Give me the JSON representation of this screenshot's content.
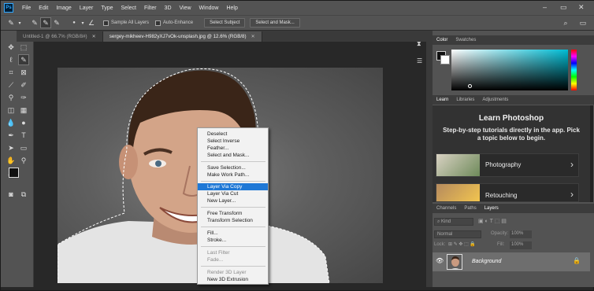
{
  "app": {
    "logo_text": "Ps"
  },
  "menubar": {
    "items": [
      "File",
      "Edit",
      "Image",
      "Layer",
      "Type",
      "Select",
      "Filter",
      "3D",
      "View",
      "Window",
      "Help"
    ]
  },
  "options_bar": {
    "sample_all_layers": "Sample All Layers",
    "auto_enhance": "Auto-Enhance",
    "select_subject": "Select Subject",
    "select_and_mask": "Select and Mask..."
  },
  "doc_tabs": [
    {
      "label": "Untitled-1 @ 66.7% (RGB/8#)"
    },
    {
      "label": "sergey-mikheev-H982yXJ7vOk-unsplash.jpg @ 12.6% (RGB/8)"
    }
  ],
  "context_menu": {
    "items": [
      {
        "label": "Deselect"
      },
      {
        "label": "Select Inverse"
      },
      {
        "label": "Feather..."
      },
      {
        "label": "Select and Mask..."
      },
      {
        "label": "Save Selection..."
      },
      {
        "label": "Make Work Path..."
      },
      {
        "label": "Layer Via Copy",
        "selected": true
      },
      {
        "label": "Layer Via Cut"
      },
      {
        "label": "New Layer..."
      },
      {
        "label": "Free Transform"
      },
      {
        "label": "Transform Selection"
      },
      {
        "label": "Fill..."
      },
      {
        "label": "Stroke..."
      },
      {
        "label": "Last Filter",
        "disabled": true
      },
      {
        "label": "Fade...",
        "disabled": true
      },
      {
        "label": "Render 3D Layer",
        "disabled": true
      },
      {
        "label": "New 3D Extrusion"
      }
    ]
  },
  "color_panel": {
    "tabs": [
      "Color",
      "Swatches"
    ]
  },
  "learn_panel": {
    "tabs": [
      "Learn",
      "Libraries",
      "Adjustments"
    ],
    "title": "Learn Photoshop",
    "description": "Step-by-step tutorials directly in the app. Pick a topic below to begin.",
    "cards": [
      {
        "label": "Photography"
      },
      {
        "label": "Retouching"
      }
    ]
  },
  "layers_panel": {
    "tabs": [
      "Channels",
      "Paths",
      "Layers"
    ],
    "kind_label": "Kind",
    "blend_mode": "Normal",
    "opacity_label": "Opacity:",
    "opacity_value": "100%",
    "lock_label": "Lock:",
    "fill_label": "Fill:",
    "fill_value": "100%",
    "layer_name": "Background"
  }
}
